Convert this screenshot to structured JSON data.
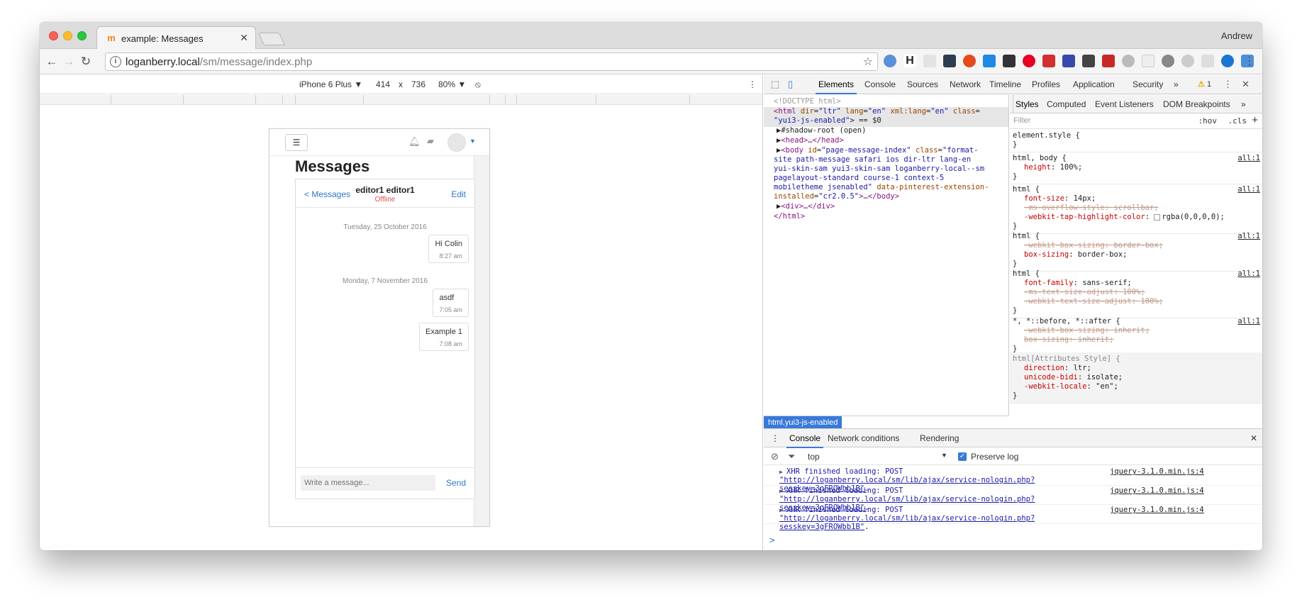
{
  "browser": {
    "tab_title": "example: Messages",
    "profile_name": "Andrew",
    "url_host": "loganberry.local",
    "url_path": "/sm/message/index.php",
    "accent": "#3879d9"
  },
  "device_toolbar": {
    "device": "iPhone 6 Plus ▼",
    "width": "414",
    "times": "x",
    "height": "736",
    "zoom": "80% ▼"
  },
  "page": {
    "heading": "Messages",
    "back_link": "< Messages",
    "contact_name": "editor1 editor1",
    "contact_status": "Offline",
    "edit_link": "Edit",
    "days": [
      {
        "label": "Tuesday, 25 October 2016",
        "messages": [
          {
            "text": "Hi Colin",
            "time": "8:27 am"
          }
        ]
      },
      {
        "label": "Monday, 7 November 2016",
        "messages": [
          {
            "text": "asdf",
            "time": "7:05 am"
          },
          {
            "text": "Example 1",
            "time": "7:08 am"
          }
        ]
      }
    ],
    "compose_placeholder": "Write a message...",
    "send_label": "Send"
  },
  "devtools": {
    "tabs": [
      "Elements",
      "Console",
      "Sources",
      "Network",
      "Timeline",
      "Profiles",
      "Application",
      "Security"
    ],
    "active_tab": "Elements",
    "warning_count": "1",
    "more_tabs": "»",
    "elements": {
      "doctype": "<!DOCTYPE html>",
      "html_open_1": "<html",
      "html_attr_dir": " dir",
      "html_val_dir": "\"ltr\"",
      "html_attr_lang": " lang",
      "html_val_lang": "\"en\"",
      "html_attr_xml": " xml:lang",
      "html_val_xml": "\"en\"",
      "html_attr_class": " class",
      "html_val_class": "\"yui3-js-enabled\"",
      "html_close_marker": "> == $0",
      "shadow_root": "#shadow-root (open)",
      "head": "<head>…</head>",
      "body_open": "<body",
      "body_attr_id": " id",
      "body_val_id": "\"page-message-index\"",
      "body_attr_class": " class",
      "body_class_lines": [
        "\"format-",
        "site  path-message safari ios dir-ltr lang-en",
        "yui-skin-sam yui3-skin-sam loganberry-local--sm",
        "pagelayout-standard course-1 context-5",
        "mobiletheme  jsenabled\""
      ],
      "body_attr_pinterest": " data-pinterest-extension-",
      "body_attr_pinterest_2": "installed",
      "body_val_pinterest": "\"cr2.0.5\"",
      "body_close": ">…</body>",
      "div": "<div>…</div>",
      "html_close": "</html>",
      "breadcrumb": "html.yui3-js-enabled"
    },
    "styles": {
      "tabs": [
        "Styles",
        "Computed",
        "Event Listeners",
        "DOM Breakpoints"
      ],
      "more": "»",
      "filter_placeholder": "Filter",
      "hov": ":hov",
      "cls": ".cls",
      "plus": "+",
      "rules": [
        {
          "selector": "element.style {",
          "source": "",
          "ua": false,
          "decls": []
        },
        {
          "selector": "html, body {",
          "source": "all:1",
          "ua": false,
          "decls": [
            {
              "name": "height",
              "value": "100%;",
              "strike": false
            }
          ]
        },
        {
          "selector": "html {",
          "source": "all:1",
          "ua": false,
          "decls": [
            {
              "name": "font-size",
              "value": "14px;",
              "strike": false
            },
            {
              "name": "-ms-overflow-style",
              "value": "scrollbar;",
              "strike": true
            },
            {
              "name": "-webkit-tap-highlight-color",
              "value": "rgba(0,0,0,0);",
              "strike": false,
              "swatch": true
            }
          ]
        },
        {
          "selector": "html {",
          "source": "all:1",
          "ua": false,
          "decls": [
            {
              "name": "-webkit-box-sizing",
              "value": "border-box;",
              "strike": true
            },
            {
              "name": "box-sizing",
              "value": "border-box;",
              "strike": false
            }
          ]
        },
        {
          "selector": "html {",
          "source": "all:1",
          "ua": false,
          "decls": [
            {
              "name": "font-family",
              "value": "sans-serif;",
              "strike": false
            },
            {
              "name": "-ms-text-size-adjust",
              "value": "100%;",
              "strike": true
            },
            {
              "name": "-webkit-text-size-adjust",
              "value": "100%;",
              "strike": true
            }
          ]
        },
        {
          "selector": "*, *::before, *::after {",
          "source": "all:1",
          "ua": false,
          "decls": [
            {
              "name": "-webkit-box-sizing",
              "value": "inherit;",
              "strike": true
            },
            {
              "name": "box-sizing",
              "value": "inherit;",
              "strike": true
            }
          ]
        },
        {
          "selector": "html[Attributes Style] {",
          "source": "",
          "ua": true,
          "decls": [
            {
              "name": "direction",
              "value": "ltr;",
              "strike": false
            },
            {
              "name": "unicode-bidi",
              "value": "isolate;",
              "strike": false
            },
            {
              "name": "-webkit-locale",
              "value": "\"en\";",
              "strike": false
            }
          ]
        }
      ],
      "close_brace": "}"
    },
    "drawer": {
      "tabs": [
        "Console",
        "Network conditions",
        "Rendering"
      ],
      "active_tab": "Console",
      "context": "top",
      "preserve_log_label": "Preserve log",
      "logs": [
        {
          "prefix": "XHR finished loading: POST ",
          "url": "\"http://loganberry.local/sm/lib/ajax/service-nologin.php?sesskey=3gFROWbb1B\"",
          "suffix": ".",
          "source": "jquery-3.1.0.min.js:4"
        },
        {
          "prefix": "XHR finished loading: POST ",
          "url": "\"http://loganberry.local/sm/lib/ajax/service-nologin.php?sesskey=3gFROWbb1B\"",
          "suffix": ".",
          "source": "jquery-3.1.0.min.js:4"
        },
        {
          "prefix": "XHR finished loading: POST ",
          "url": "\"http://loganberry.local/sm/lib/ajax/service-nologin.php?sesskey=3gFROWbb1B\"",
          "suffix": ".",
          "source": "jquery-3.1.0.min.js:4"
        }
      ],
      "prompt": ">"
    }
  }
}
